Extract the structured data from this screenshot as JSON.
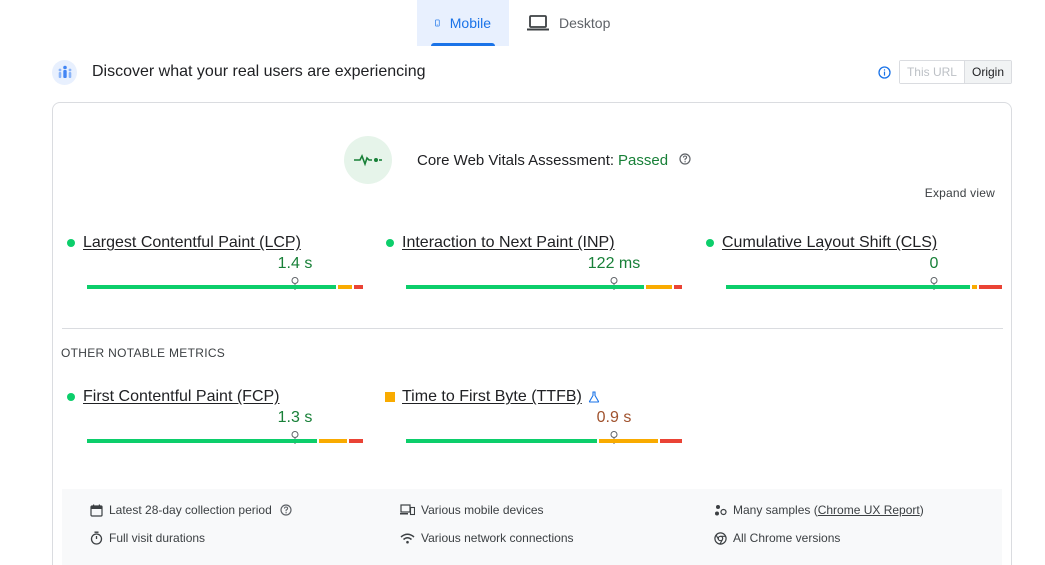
{
  "tabs": [
    {
      "label": "Mobile",
      "icon": "phone-icon",
      "active": true
    },
    {
      "label": "Desktop",
      "icon": "laptop-icon",
      "active": false
    }
  ],
  "header": {
    "title": "Discover what your real users are experiencing",
    "toggle_left": "This URL",
    "toggle_right": "Origin"
  },
  "assessment": {
    "label": "Core Web Vitals Assessment:",
    "status": "Passed"
  },
  "expand_label": "Expand view",
  "core_metrics": [
    {
      "name": "Largest Contentful Paint (LCP)",
      "value": "1.4 s",
      "status": "good"
    },
    {
      "name": "Interaction to Next Paint (INP)",
      "value": "122 ms",
      "status": "good"
    },
    {
      "name": "Cumulative Layout Shift (CLS)",
      "value": "0",
      "status": "good"
    }
  ],
  "other_title": "OTHER NOTABLE METRICS",
  "other_metrics": [
    {
      "name": "First Contentful Paint (FCP)",
      "value": "1.3 s",
      "status": "good"
    },
    {
      "name": "Time to First Byte (TTFB)",
      "value": "0.9 s",
      "status": "needs-improvement"
    }
  ],
  "footer": {
    "collection": "Latest 28-day collection period",
    "visits": "Full visit durations",
    "devices": "Various mobile devices",
    "network": "Various network connections",
    "samples_prefix": "Many samples (",
    "samples_link": "Chrome UX Report",
    "samples_suffix": ")",
    "versions": "All Chrome versions"
  },
  "colors": {
    "accent": "#1a73e8",
    "good": "#0cce6b",
    "good_text": "#188038",
    "average": "#f9ab00",
    "poor": "#ea4335",
    "average_text": "#a0522d"
  }
}
